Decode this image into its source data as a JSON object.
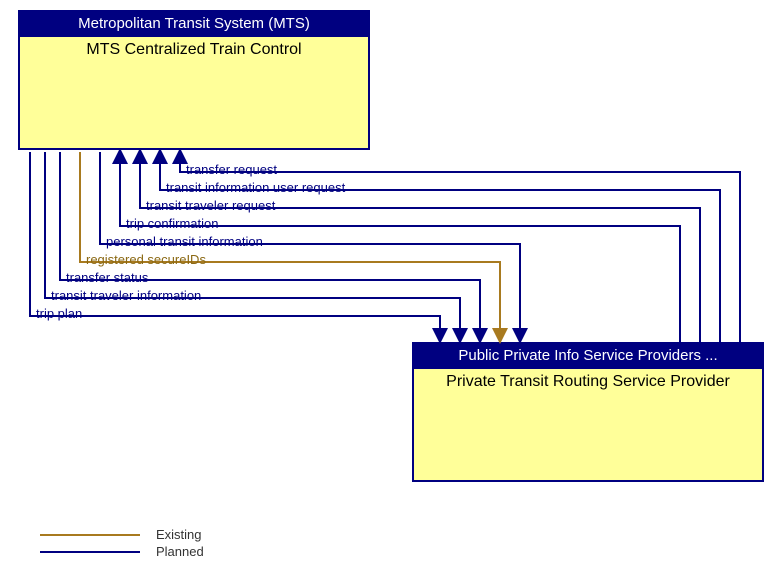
{
  "entities": {
    "top": {
      "header": "Metropolitan Transit System (MTS)",
      "body": "MTS Centralized Train Control"
    },
    "bottom": {
      "header": "Public Private Info Service Providers ...",
      "body": "Private Transit Routing Service Provider"
    }
  },
  "flows": {
    "f1": {
      "label": "transfer request"
    },
    "f2": {
      "label": "transit information user request"
    },
    "f3": {
      "label": "transit traveler request"
    },
    "f4": {
      "label": "trip confirmation"
    },
    "f5": {
      "label": "personal transit information"
    },
    "f6": {
      "label": "registered secureIDs"
    },
    "f7": {
      "label": "transfer status"
    },
    "f8": {
      "label": "transit traveler information"
    },
    "f9": {
      "label": "trip plan"
    }
  },
  "legend": {
    "existing": "Existing",
    "planned": "Planned"
  },
  "colors": {
    "planned": "#000080",
    "existing": "#a87a1f",
    "entity_fill": "#ffff99",
    "header_fill": "#000080"
  }
}
